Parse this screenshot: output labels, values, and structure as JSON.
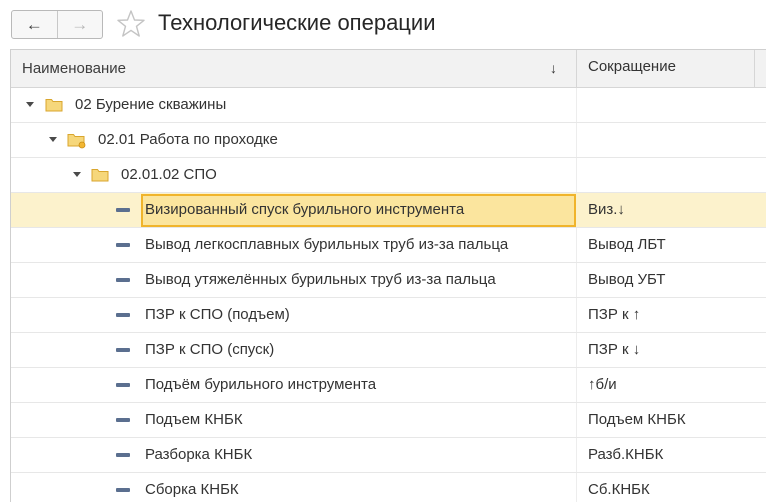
{
  "header": {
    "back_icon": "←",
    "forward_icon": "→",
    "title": "Технологические операции"
  },
  "grid": {
    "columns": {
      "name": "Наименование",
      "sort_icon": "↓",
      "abbreviation": "Сокращение"
    },
    "groups": [
      {
        "label": "02 Бурение скважины"
      },
      {
        "label": "02.01 Работа по проходке"
      },
      {
        "label": "02.01.02 СПО"
      }
    ],
    "rows": [
      {
        "name": "Визированный спуск бурильного инструмента",
        "abbr": "Виз.↓"
      },
      {
        "name": "Вывод легкосплавных бурильных труб из-за пальца",
        "abbr": "Вывод ЛБТ"
      },
      {
        "name": "Вывод утяжелённых бурильных труб из-за пальца",
        "abbr": "Вывод УБТ"
      },
      {
        "name": "ПЗР к СПО (подъем)",
        "abbr": "ПЗР к ↑"
      },
      {
        "name": "ПЗР к СПО (спуск)",
        "abbr": "ПЗР к ↓"
      },
      {
        "name": "Подъём бурильного инструмента",
        "abbr": "↑б/и"
      },
      {
        "name": "Подъем КНБК",
        "abbr": "Подъем КНБК"
      },
      {
        "name": "Разборка КНБК",
        "abbr": "Разб.КНБК"
      },
      {
        "name": "Сборка КНБК",
        "abbr": "Сб.КНБК"
      }
    ]
  },
  "colors": {
    "selection_fill": "#fcf2cc",
    "selection_border": "#f0b42b",
    "folder": "#f2c94c",
    "item_icon": "#5b6f8f"
  }
}
